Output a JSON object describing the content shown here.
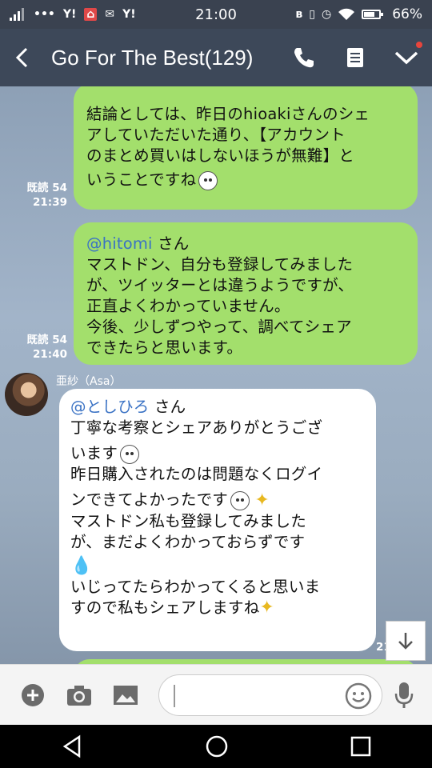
{
  "status_bar": {
    "time": "21:00",
    "battery": "66%",
    "left_icons": [
      "signal-icon",
      "more-dots-icon",
      "yahoo-icon",
      "shopping-icon",
      "mail-icon",
      "yahoo-icon"
    ],
    "right_icons": [
      "bluetooth-icon",
      "vibrate-icon",
      "alarm-icon",
      "wifi-icon",
      "battery-icon"
    ]
  },
  "header": {
    "title": "Go For The Best(129)",
    "icons": [
      "back-icon",
      "phone-icon",
      "notes-icon",
      "chevron-down-icon"
    ]
  },
  "messages": [
    {
      "type": "outgoing",
      "lines": [
        "結論としては、昨日のhioakiさんのシェ",
        "アしていただいた通り、【アカウント",
        "のまとめ買いはしないほうが無難】と",
        "いうことですね"
      ],
      "read": "既読 54",
      "time": "21:39"
    },
    {
      "type": "outgoing",
      "mention": "@hitomi",
      "mention_suffix": " さん",
      "lines": [
        "マストドン、自分も登録してみました",
        "が、ツイッターとは違うようですが、",
        "正直よくわかっていません。",
        "今後、少しずつやって、調べてシェア",
        "できたらと思います。"
      ],
      "read": "既読 54",
      "time": "21:40"
    },
    {
      "type": "incoming",
      "sender": "亜紗（Asa）",
      "mention": "@としひろ",
      "mention_suffix": " さん",
      "lines": [
        "丁寧な考察とシェアありがとうござ",
        "います",
        "昨日購入されたのは問題なくログイ",
        "ンできてよかったです",
        "マストドン私も登録してみました",
        "が、まだよくわかっておらずです",
        "いじってたらわかってくると思いま",
        "すので私もシェアしますね"
      ],
      "time": "21"
    }
  ],
  "input": {
    "placeholder": "",
    "icons": [
      "add-icon",
      "camera-icon",
      "image-icon",
      "emoji-icon",
      "microphone-icon"
    ]
  },
  "navbar": {
    "icons": [
      "nav-back-icon",
      "nav-home-icon",
      "nav-recents-icon"
    ]
  },
  "colors": {
    "outgoing_bubble": "#a3df6c",
    "incoming_bubble": "#ffffff",
    "header_bg": "#3d4859",
    "mention": "#3a72c4"
  }
}
